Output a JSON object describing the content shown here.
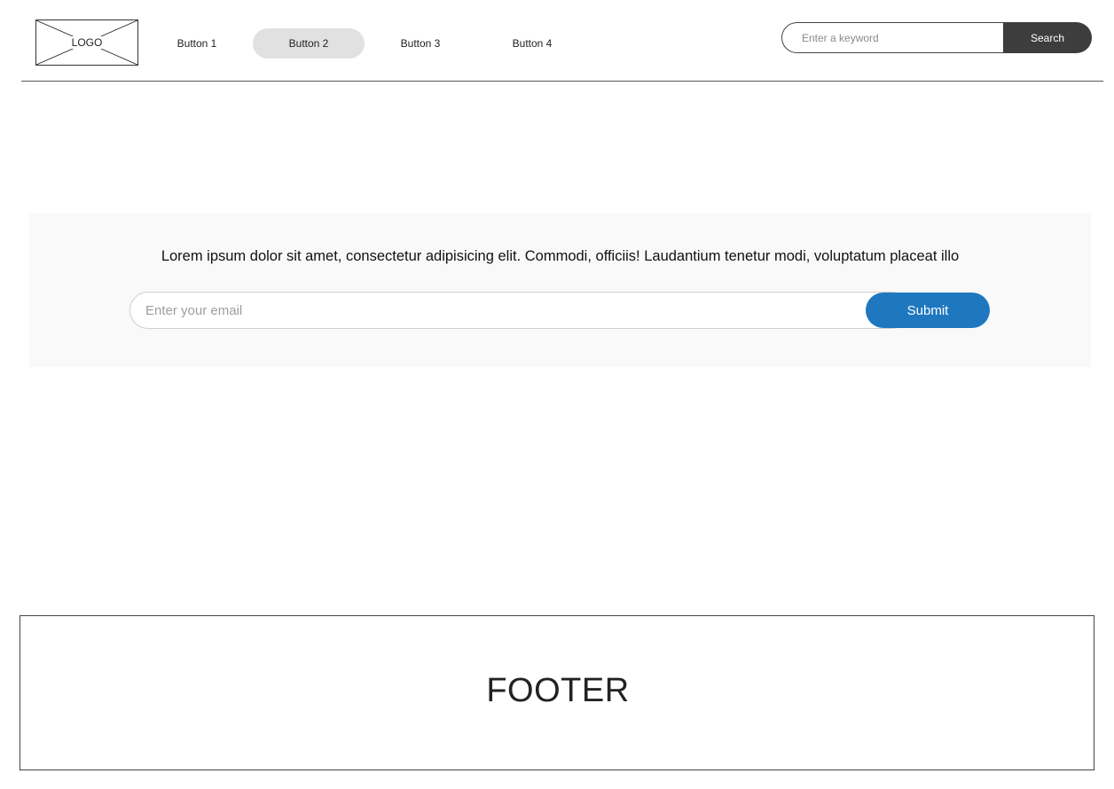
{
  "header": {
    "logo_label": "LOGO",
    "nav": [
      {
        "label": "Button 1",
        "active": false
      },
      {
        "label": "Button 2",
        "active": true
      },
      {
        "label": "Button 3",
        "active": false
      },
      {
        "label": "Button 4",
        "active": false
      }
    ],
    "search": {
      "placeholder": "Enter a keyword",
      "button_label": "Search"
    }
  },
  "newsletter": {
    "text": "Lorem ipsum dolor sit amet, consectetur adipisicing elit. Commodi, officiis! Laudantium tenetur modi, voluptatum placeat illo",
    "email_placeholder": "Enter your email",
    "submit_label": "Submit"
  },
  "footer": {
    "label": "FOOTER"
  },
  "colors": {
    "primary": "#1f78bf",
    "search_button": "#3d3d3d",
    "active_nav": "#e1e1e1",
    "band_background": "#f9f9f9"
  }
}
